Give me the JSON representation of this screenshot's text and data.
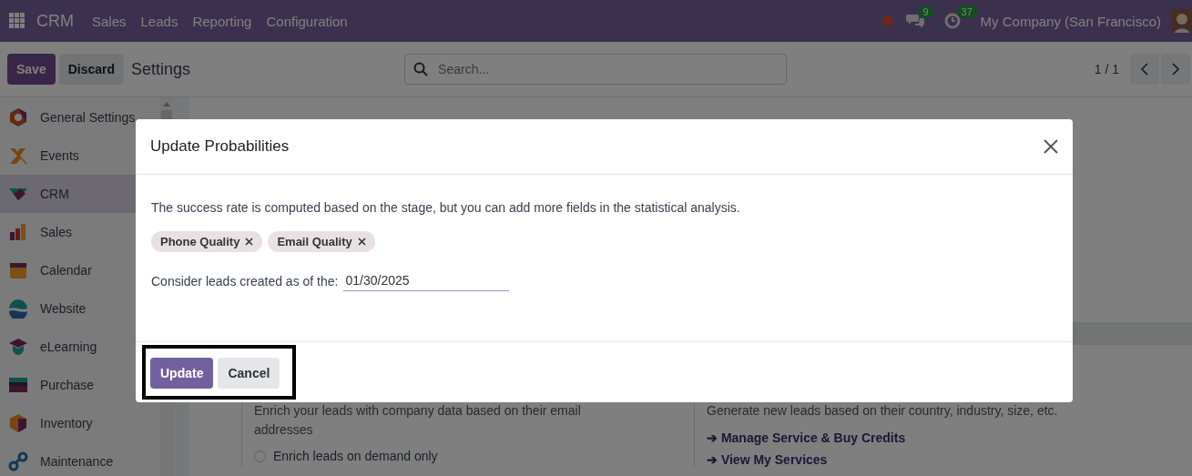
{
  "navbar": {
    "app": "CRM",
    "menu": [
      "Sales",
      "Leads",
      "Reporting",
      "Configuration"
    ],
    "messages_badge": "9",
    "activities_badge": "37",
    "company": "My Company (San Francisco)"
  },
  "control_bar": {
    "buttons": [
      "Save",
      "Discard"
    ],
    "title": "Settings",
    "search": {
      "placeholder": "Search..."
    },
    "pager": "1 / 1"
  },
  "sidebar": {
    "items": [
      {
        "label": "General Settings",
        "selected": false
      },
      {
        "label": "Events",
        "selected": false
      },
      {
        "label": "CRM",
        "selected": true
      },
      {
        "label": "Sales",
        "selected": false
      },
      {
        "label": "Calendar",
        "selected": false
      },
      {
        "label": "Website",
        "selected": false
      },
      {
        "label": "eLearning",
        "selected": false
      },
      {
        "label": "Purchase",
        "selected": false
      },
      {
        "label": "Inventory",
        "selected": false
      },
      {
        "label": "Maintenance",
        "selected": false
      }
    ]
  },
  "content": {
    "left": {
      "description": "Enrich your leads with company data based on their email addresses",
      "options": [
        {
          "label": "Enrich leads on demand only",
          "selected": false
        }
      ]
    },
    "right": {
      "description": "Generate new leads based on their country, industry, size, etc.",
      "links": [
        "➔ Manage Service & Buy Credits",
        "➔ View My Services"
      ]
    }
  },
  "dialog": {
    "title": "Update Probabilities",
    "message": "The success rate is computed based on the stage, but you can add more fields in the statistical analysis.",
    "tags": [
      "Phone Quality",
      "Email Quality"
    ],
    "date_label": "Consider leads created as of the:",
    "date_value": "01/30/2025",
    "buttons": [
      {
        "label": "Update",
        "kind": "primary"
      },
      {
        "label": "Cancel",
        "kind": "secondary"
      }
    ]
  }
}
